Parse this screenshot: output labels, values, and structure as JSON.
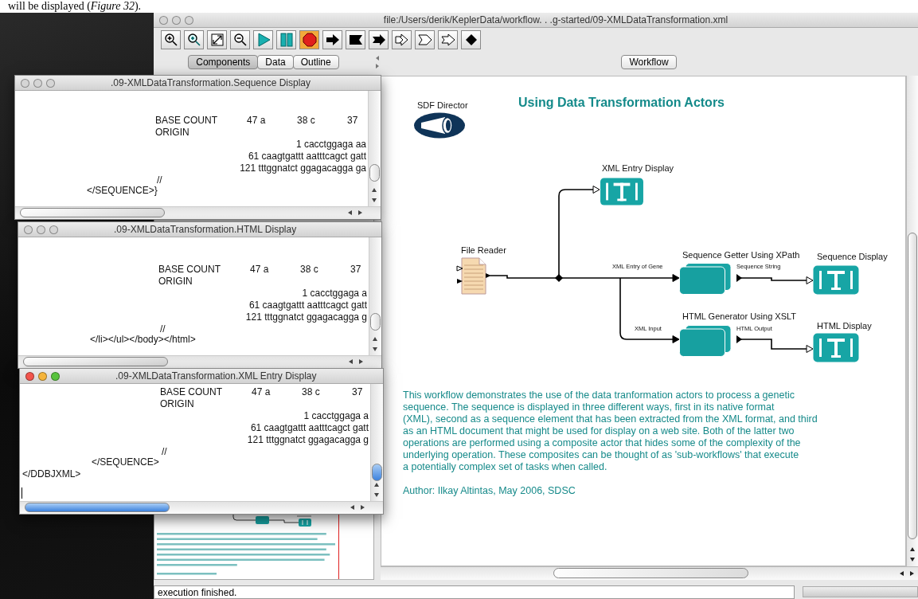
{
  "caption": "will be displayed (*Figure 32*).",
  "main_window": {
    "title": "file:/Users/derik/KeplerData/workflow. . .g-started/09-XMLDataTransformation.xml",
    "active": false,
    "toolbar": [
      {
        "kind": "zoom-in",
        "selected": false
      },
      {
        "kind": "zoom-reset",
        "selected": false
      },
      {
        "kind": "zoom-fit",
        "selected": false
      },
      {
        "kind": "zoom-out",
        "selected": false
      },
      {
        "kind": "run",
        "selected": false
      },
      {
        "kind": "pause",
        "selected": false
      },
      {
        "kind": "stop",
        "selected": true
      },
      {
        "kind": "arrow",
        "selected": false
      },
      {
        "kind": "banner",
        "selected": false
      },
      {
        "kind": "arrow-notch",
        "selected": false
      },
      {
        "kind": "outline-arrow",
        "selected": false
      },
      {
        "kind": "outline-banner",
        "selected": false
      },
      {
        "kind": "outline-notch",
        "selected": false
      },
      {
        "kind": "diamond",
        "selected": false
      }
    ],
    "left_tabs": [
      {
        "label": "Components",
        "selected": true
      },
      {
        "label": "Data",
        "selected": false
      },
      {
        "label": "Outline",
        "selected": false
      }
    ],
    "right_tab": "Workflow",
    "status": "execution finished."
  },
  "canvas": {
    "director_label": "SDF Director",
    "title": "Using Data Transformation Actors",
    "nodes": [
      {
        "kind": "display",
        "label": "XML Entry Display"
      },
      {
        "kind": "file",
        "label": "File Reader"
      },
      {
        "kind": "composite",
        "label": "Sequence Getter Using XPath"
      },
      {
        "kind": "display",
        "label": "Sequence Display"
      },
      {
        "kind": "composite",
        "label": "HTML Generator Using XSLT"
      },
      {
        "kind": "display",
        "label": "HTML Display"
      }
    ],
    "edge_labels": [
      "XML Entry of Gene",
      "Sequence String",
      "XML Input",
      "HTML Output"
    ],
    "description_lines": [
      "This workflow demonstrates the use of the data tranformation actors to process a genetic",
      "sequence.  The sequence is displayed in three different ways, first in its native format",
      "(XML), second as a sequence element that has been extracted from the XML format, and third",
      "as an HTML document that might be used for display on a web site. Both of the latter two",
      "operations are performed using a composite actor that hides some of the complexity of the",
      "underlying operation.  These composites can be thought of as 'sub-workflows' that execute",
      "a potentially complex set of tasks when called."
    ],
    "author": "Author: Ilkay Altintas, May 2006, SDSC"
  },
  "windows": [
    {
      "title": ".09-XMLDataTransformation.Sequence Display",
      "active": false,
      "base_count": "BASE COUNT",
      "counts": [
        "47 a",
        "38 c",
        "37"
      ],
      "origin": "ORIGIN",
      "sequence": [
        "1 cacctggaga aa",
        "61 caagtgattt aatttcagct gatt",
        "121 tttggnatct ggagacagga ga"
      ],
      "end_mark": "//",
      "closing": [
        "</SEQUENCE>}"
      ]
    },
    {
      "title": ".09-XMLDataTransformation.HTML Display",
      "active": false,
      "base_count": "BASE COUNT",
      "counts": [
        "47 a",
        "38 c",
        "37"
      ],
      "origin": "ORIGIN",
      "sequence": [
        "1 cacctggaga a",
        "61 caagtgattt aatttcagct gatt",
        "121 tttggnatct ggagacagga g"
      ],
      "end_mark": "//",
      "closing": [
        "</li></ul></body></html>"
      ]
    },
    {
      "title": ".09-XMLDataTransformation.XML Entry Display",
      "active": true,
      "base_count": "BASE COUNT",
      "counts": [
        "47 a",
        "38 c",
        "37"
      ],
      "origin": "ORIGIN",
      "sequence": [
        "1 cacctggaga a",
        "61 caagtgattt aatttcagct gatt",
        "121 tttggnatct ggagacagga g"
      ],
      "end_mark": "//",
      "closing": [
        "</SEQUENCE>",
        "</DDBJXML>"
      ]
    }
  ]
}
